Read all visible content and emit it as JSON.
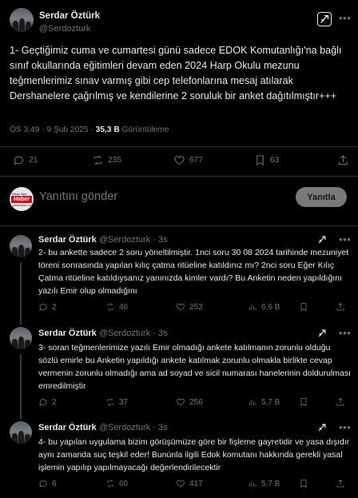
{
  "main_tweet": {
    "author_name": "Serdar Öztürk",
    "author_handle": "@Serdozturk",
    "text": "1- Geçtiğimiz cuma ve cumartesi günü sadece EDOK Komutanlığı'na bağlı sınıf okullarında eğitimleri devam eden 2024 Harp Okulu mezunu teğmenlerimiz sınav varmış gibi cep telefonlarına mesaj atılarak Dershanelere çağrılmış ve kendilerine 2 soruluk bir anket dağıtılmıştır+++",
    "time": "ÖS 3:49",
    "date": "9 Şub 2025",
    "views_count": "35,3 B",
    "views_label": "Görüntüleme",
    "replies": "21",
    "reposts": "235",
    "likes": "677",
    "bookmarks": "63"
  },
  "reply_box": {
    "avatar_logo_top": "Köşe Yazı",
    "avatar_logo_mid": "Haber",
    "avatar_logo_bot": "yazarhaber.com",
    "placeholder": "Yanıtını gönder",
    "button_label": "Yanıtla"
  },
  "thread": [
    {
      "author_name": "Serdar Öztürk",
      "author_handle": "@Serdozturk",
      "age": "3s",
      "text": "2- bu ankette sadece 2 soru yöneltilmiştir. 1nci soru 30 08 2024 tarihinde mezuniyet töreni sonrasında yapılan kılıç çatma ritüeline katıldınız mı? 2nci soru Eğer Kılıç Çatma ritüeline katıldıysanız yanınızda kimler vardı? Bu Anketin neden yapıldığını yazılı Emir olup olmadığını",
      "replies": "2",
      "reposts": "46",
      "likes": "252",
      "views": "6,6 B"
    },
    {
      "author_name": "Serdar Öztürk",
      "author_handle": "@Serdozturk",
      "age": "3s",
      "text": "3- soran teğmenlerimize yazılı Emir olmadığı ankete katılmanın zorunlu olduğu sözlü emirle bu Anketin yapıldığı ankete katılmak zorunlu olmakla birlikte cevap vermenin zorunlu olmadığı ama ad soyad ve sicil numarası hanelerinin doldurulması emredilmiştir",
      "replies": "2",
      "reposts": "37",
      "likes": "256",
      "views": "5,7 B"
    },
    {
      "author_name": "Serdar Öztürk",
      "author_handle": "@Serdozturk",
      "age": "3s",
      "text": "4- bu yapılan uygulama bizim görüşümüze göre bir fişleme gayretidir ve yasa dışıdır aynı zamanda suç teşkil eder! Bunu̇nla ilgili Edok komutanı hakkında gerekli yasal işlemin yapılıp yapılmayacağı değerlendirilecektir",
      "replies": "6",
      "reposts": "60",
      "likes": "417",
      "views": "5,7 B"
    }
  ],
  "icons": {
    "grok": "grok-icon",
    "more": "more-icon",
    "reply": "reply-icon",
    "repost": "repost-icon",
    "like": "heart-icon",
    "views": "views-icon",
    "bookmark": "bookmark-icon"
  }
}
